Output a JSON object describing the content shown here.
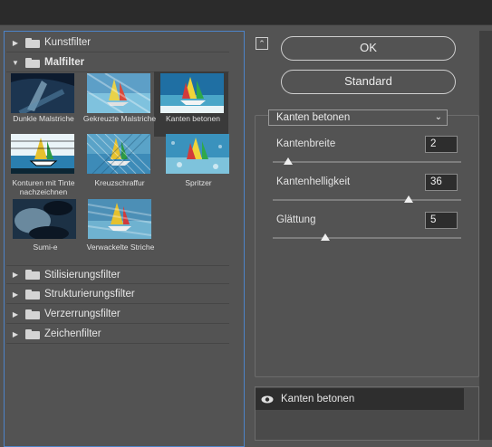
{
  "left_panel": {
    "categories_top": [
      {
        "label": "Kunstfilter",
        "expanded": false
      }
    ],
    "open_category": {
      "label": "Malfilter",
      "expanded": true
    },
    "filters": [
      {
        "label": "Dunkle Malstriche"
      },
      {
        "label": "Gekreuzte Malstriche"
      },
      {
        "label": "Kanten betonen",
        "selected": true
      },
      {
        "label": "Konturen mit Tinte nachzeichnen"
      },
      {
        "label": "Kreuzschraffur"
      },
      {
        "label": "Spritzer"
      },
      {
        "label": "Sumi-e"
      },
      {
        "label": "Verwackelte Striche"
      }
    ],
    "categories_bottom": [
      {
        "label": "Stilisierungsfilter",
        "expanded": false
      },
      {
        "label": "Strukturierungsfilter",
        "expanded": false
      },
      {
        "label": "Verzerrungsfilter",
        "expanded": false
      },
      {
        "label": "Zeichenfilter",
        "expanded": false
      }
    ]
  },
  "buttons": {
    "ok_label": "OK",
    "standard_label": "Standard",
    "collapse_icon": "collapse-up-icon"
  },
  "settings": {
    "selected_filter": "Kanten betonen",
    "params": [
      {
        "label": "Kantenbreite",
        "value": "2",
        "slider_fraction": 0.08
      },
      {
        "label": "Kantenhelligkeit",
        "value": "36",
        "slider_fraction": 0.72
      },
      {
        "label": "Glättung",
        "value": "5",
        "slider_fraction": 0.28
      }
    ]
  },
  "layers": {
    "items": [
      {
        "label": "Kanten betonen",
        "visible": true
      }
    ]
  },
  "colors": {
    "background": "#535353",
    "selection_border": "#4d83c8",
    "input_bg": "#2d2d2d"
  }
}
